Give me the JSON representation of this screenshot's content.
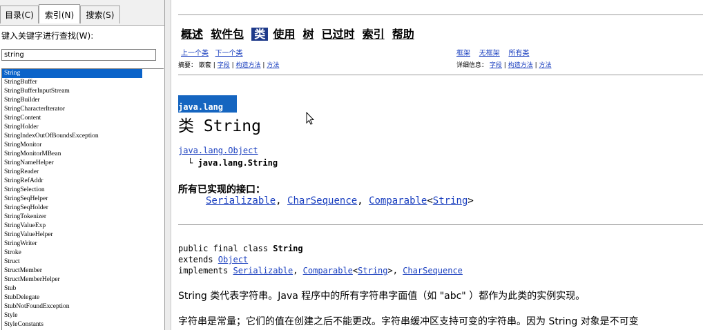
{
  "left_pane": {
    "tabs": [
      {
        "label": "目录(C)"
      },
      {
        "label": "索引(N)"
      },
      {
        "label": "搜索(S)"
      }
    ],
    "keyword_label": "键入关键字进行查找(W):",
    "search_value": "string",
    "items": [
      {
        "label": "String"
      },
      {
        "label": "StringBuffer"
      },
      {
        "label": "StringBufferInputStream"
      },
      {
        "label": "StringBuilder"
      },
      {
        "label": "StringCharacterIterator"
      },
      {
        "label": "StringContent"
      },
      {
        "label": "StringHolder"
      },
      {
        "label": "StringIndexOutOfBoundsException"
      },
      {
        "label": "StringMonitor"
      },
      {
        "label": "StringMonitorMBean"
      },
      {
        "label": "StringNameHelper"
      },
      {
        "label": "StringReader"
      },
      {
        "label": "StringRefAddr"
      },
      {
        "label": "StringSelection"
      },
      {
        "label": "StringSeqHelper"
      },
      {
        "label": "StringSeqHolder"
      },
      {
        "label": "StringTokenizer"
      },
      {
        "label": "StringValueExp"
      },
      {
        "label": "StringValueHelper"
      },
      {
        "label": "StringWriter"
      },
      {
        "label": "Stroke"
      },
      {
        "label": "Struct"
      },
      {
        "label": "StructMember"
      },
      {
        "label": "StructMemberHelper"
      },
      {
        "label": "Stub"
      },
      {
        "label": "StubDelegate"
      },
      {
        "label": "StubNotFoundException"
      },
      {
        "label": "Style"
      },
      {
        "label": "StyleConstants"
      }
    ]
  },
  "nav": {
    "items": [
      {
        "label": "概述"
      },
      {
        "label": "软件包"
      },
      {
        "label": "类"
      },
      {
        "label": "使用"
      },
      {
        "label": "树"
      },
      {
        "label": "已过时"
      },
      {
        "label": "索引"
      },
      {
        "label": "帮助"
      }
    ]
  },
  "subnav": {
    "prev": "上一个类",
    "next": "下一个类",
    "frames": "框架",
    "noframes": "无框架",
    "allclasses": "所有类",
    "summary_label": "摘要：",
    "nested": "嵌套",
    "field": "字段",
    "constructor": "构造方法",
    "method": "方法",
    "detail_label": "详细信息：",
    "detail_field": "字段",
    "detail_constructor": "构造方法",
    "detail_method": "方法",
    "sep": "|"
  },
  "content": {
    "package": "java.lang",
    "class_title": "类 String",
    "parent": "java.lang.Object",
    "tree_branch": "└",
    "child": "java.lang.String",
    "interfaces_heading": "所有已实现的接口：",
    "interfaces": {
      "i1": "Serializable",
      "i2": "CharSequence",
      "i3": "Comparable",
      "i3_param": "String",
      "lt": "<",
      "gt": ">",
      "comma": ","
    },
    "decl": {
      "line1": "public final class ",
      "line1_bold": "String",
      "line2": "extends ",
      "line2_link": "Object",
      "line3": "implements ",
      "l3_a": "Serializable",
      "l3_b": "Comparable",
      "l3_b_param": "String",
      "l3_c": "CharSequence"
    },
    "para1": "String 类代表字符串。Java 程序中的所有字符串字面值（如 \"abc\" ）都作为此类的实例实现。",
    "para2": "字符串是常量；它们的值在创建之后不能更改。字符串缓冲区支持可变的字符串。因为 String 对象是不可变"
  }
}
